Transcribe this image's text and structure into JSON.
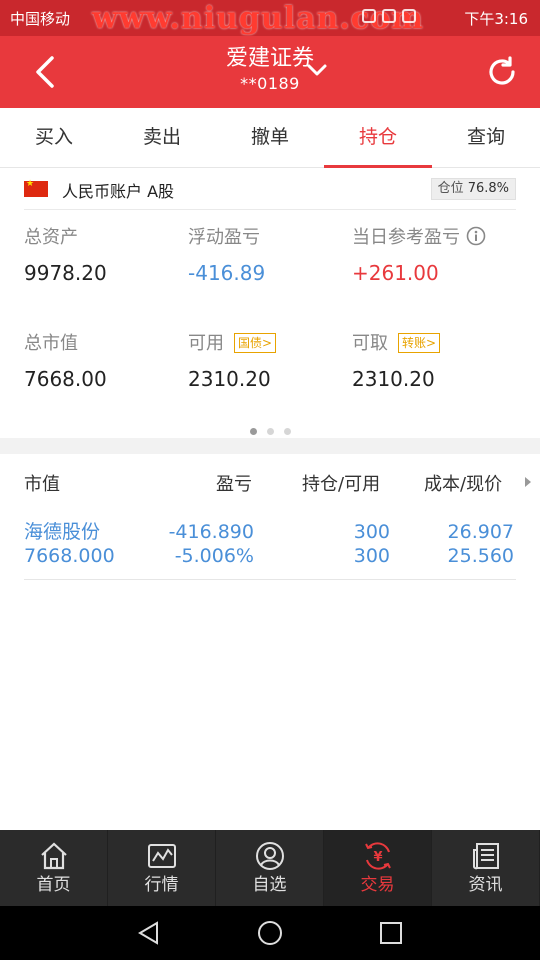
{
  "status_bar": {
    "carrier": "中国移动",
    "watermark": "www.niugulan.com",
    "time": "下午3:16"
  },
  "header": {
    "title": "爱建证券",
    "account": "**0189"
  },
  "tabs": [
    {
      "label": "买入"
    },
    {
      "label": "卖出"
    },
    {
      "label": "撤单"
    },
    {
      "label": "持仓",
      "active": true
    },
    {
      "label": "查询"
    }
  ],
  "account": {
    "label": "人民币账户 A股",
    "position_label": "仓位",
    "position_value": "76.8%"
  },
  "summary": {
    "total_assets_label": "总资产",
    "total_assets": "9978.20",
    "floating_pl_label": "浮动盈亏",
    "floating_pl": "-416.89",
    "today_pl_label": "当日参考盈亏",
    "today_pl": "+261.00",
    "market_value_label": "总市值",
    "market_value": "7668.00",
    "available_label": "可用",
    "available_tag": "国债>",
    "available": "2310.20",
    "withdrawable_label": "可取",
    "withdrawable_tag": "转账>",
    "withdrawable": "2310.20"
  },
  "pager": {
    "count": 3,
    "current": 1
  },
  "table": {
    "headers": {
      "market_value": "市值",
      "pl": "盈亏",
      "holding": "持仓/可用",
      "cost_price": "成本/现价"
    },
    "rows": [
      {
        "name": "海德股份",
        "market_value": "7668.000",
        "pl": "-416.890",
        "pl_pct": "-5.006%",
        "holding": "300",
        "available": "300",
        "cost": "26.907",
        "price": "25.560"
      }
    ]
  },
  "bottom_nav": [
    {
      "label": "首页",
      "icon": "home-icon"
    },
    {
      "label": "行情",
      "icon": "chart-icon"
    },
    {
      "label": "自选",
      "icon": "user-star-icon"
    },
    {
      "label": "交易",
      "icon": "yuan-exchange-icon",
      "active": true
    },
    {
      "label": "资讯",
      "icon": "news-icon"
    }
  ],
  "colors": {
    "brand_red": "#e8393d",
    "loss_blue": "#4a8fd8",
    "tag_orange": "#e8a300"
  }
}
